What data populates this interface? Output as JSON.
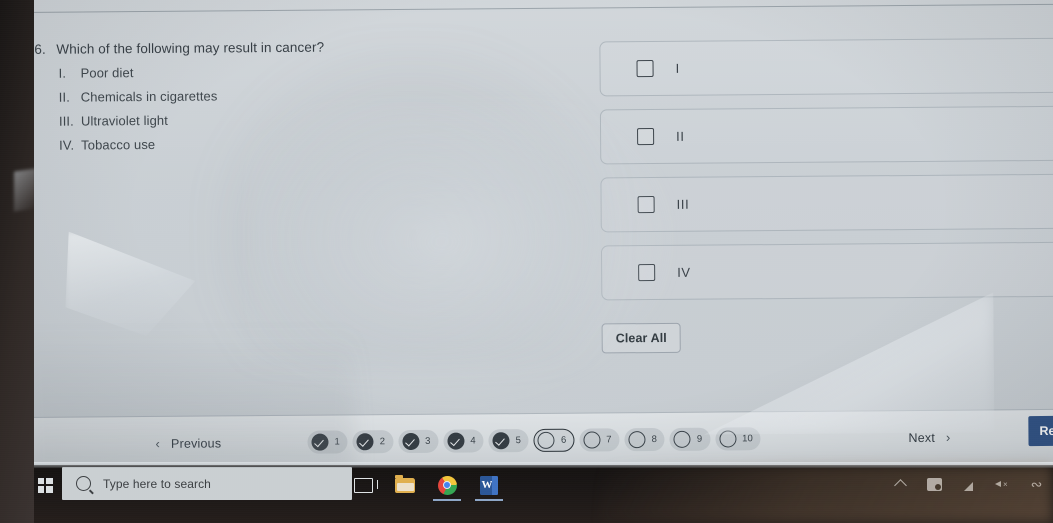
{
  "question": {
    "number": "6.",
    "prompt": "Which of the following may result in cancer?",
    "options": [
      {
        "numeral": "I.",
        "text": "Poor diet"
      },
      {
        "numeral": "II.",
        "text": "Chemicals in cigarettes"
      },
      {
        "numeral": "III.",
        "text": "Ultraviolet light"
      },
      {
        "numeral": "IV.",
        "text": "Tobacco use"
      }
    ]
  },
  "answers": {
    "rows": [
      {
        "label": "I",
        "checked": false
      },
      {
        "label": "II",
        "checked": false
      },
      {
        "label": "III",
        "checked": false
      },
      {
        "label": "IV",
        "checked": false
      }
    ],
    "clear_all_label": "Clear All"
  },
  "nav": {
    "previous_label": "Previous",
    "previous_icon": "chevron-left-icon",
    "next_label": "Next",
    "next_icon": "chevron-right-icon",
    "review_label": "Review",
    "review_color": "#2e5186",
    "pager": [
      {
        "number": "1",
        "state": "answered"
      },
      {
        "number": "2",
        "state": "answered"
      },
      {
        "number": "3",
        "state": "answered"
      },
      {
        "number": "4",
        "state": "answered"
      },
      {
        "number": "5",
        "state": "answered"
      },
      {
        "number": "6",
        "state": "current"
      },
      {
        "number": "7",
        "state": "unanswered"
      },
      {
        "number": "8",
        "state": "unanswered"
      },
      {
        "number": "9",
        "state": "unanswered"
      },
      {
        "number": "10",
        "state": "unanswered"
      }
    ]
  },
  "taskbar": {
    "start_icon": "windows-logo-icon",
    "search_placeholder": "Type here to search",
    "search_icon": "search-icon",
    "pinned": [
      {
        "icon": "task-view-icon",
        "active": false
      },
      {
        "icon": "file-explorer-icon",
        "active": false
      },
      {
        "icon": "chrome-icon",
        "active": true
      },
      {
        "icon": "word-icon",
        "active": true
      }
    ],
    "tray": [
      {
        "icon": "chevron-up-icon"
      },
      {
        "icon": "onedrive-icon"
      },
      {
        "icon": "network-icon"
      },
      {
        "icon": "speaker-muted-icon"
      },
      {
        "icon": "bluetooth-icon"
      }
    ]
  }
}
